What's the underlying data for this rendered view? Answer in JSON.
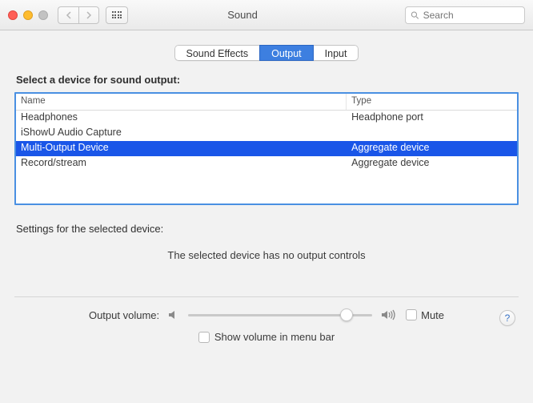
{
  "window": {
    "title": "Sound"
  },
  "search": {
    "placeholder": "Search"
  },
  "tabs": {
    "effects": "Sound Effects",
    "output": "Output",
    "input": "Input"
  },
  "section": {
    "label": "Select a device for sound output:"
  },
  "table": {
    "headers": {
      "name": "Name",
      "type": "Type"
    },
    "rows": [
      {
        "name": "Headphones",
        "type": "Headphone port",
        "selected": false
      },
      {
        "name": "iShowU Audio Capture",
        "type": "",
        "selected": false
      },
      {
        "name": "Multi-Output Device",
        "type": "Aggregate device",
        "selected": true
      },
      {
        "name": "Record/stream",
        "type": "Aggregate device",
        "selected": false
      }
    ]
  },
  "settings": {
    "label": "Settings for the selected device:",
    "message": "The selected device has no output controls"
  },
  "volume": {
    "label": "Output volume:",
    "mute": "Mute",
    "menubar": "Show volume in menu bar"
  }
}
